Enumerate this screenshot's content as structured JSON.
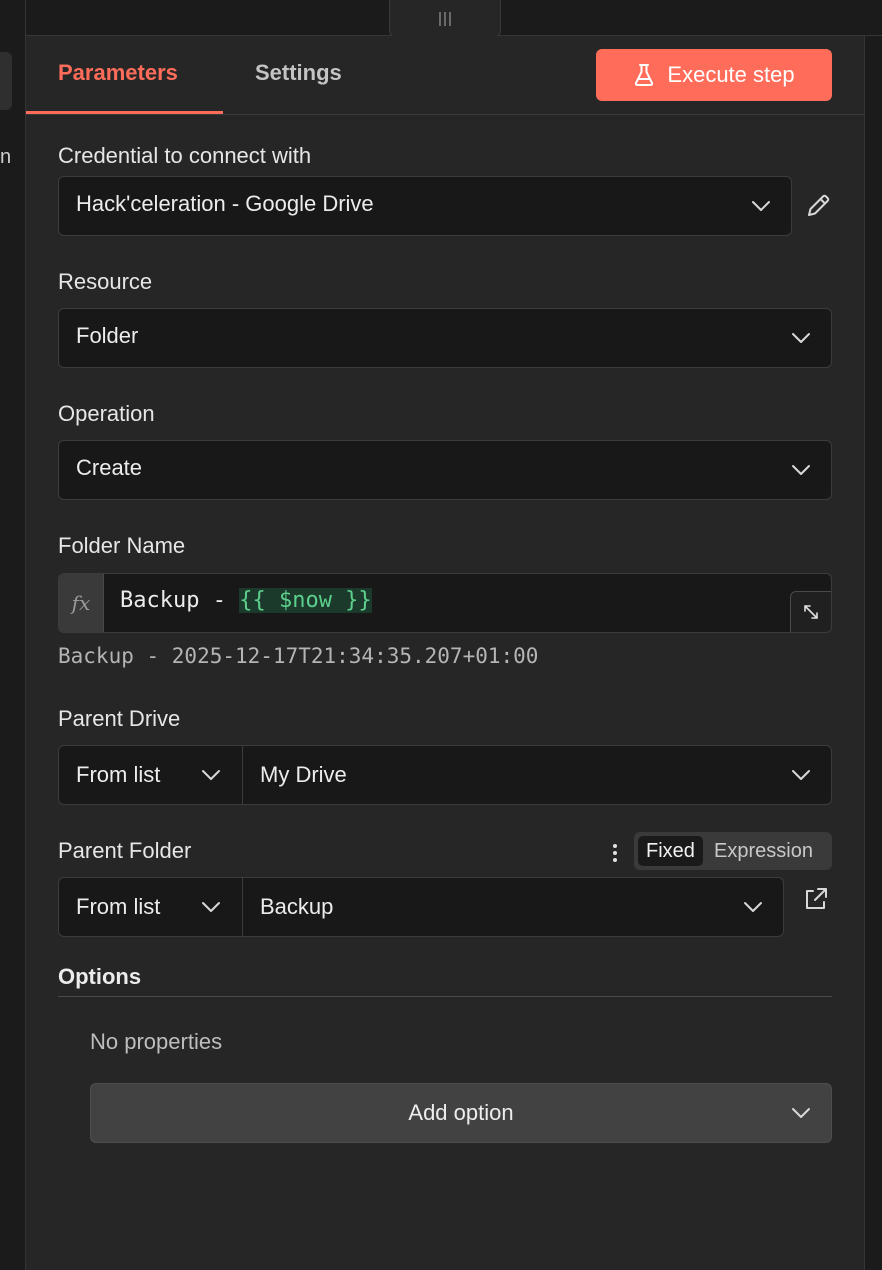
{
  "tabs": {
    "parameters": "Parameters",
    "settings": "Settings"
  },
  "execute_button": {
    "label": "Execute step",
    "icon": "flask-icon"
  },
  "left_strip": {
    "partial_letter": "n"
  },
  "credential": {
    "label": "Credential to connect with",
    "value": "Hack'celeration - Google Drive",
    "edit_icon": "pencil-icon"
  },
  "resource": {
    "label": "Resource",
    "value": "Folder"
  },
  "operation": {
    "label": "Operation",
    "value": "Create"
  },
  "folder_name": {
    "label": "Folder Name",
    "fx": "fx",
    "expression_prefix": "Backup - ",
    "expression_token": "{{ $now }}",
    "preview": "Backup - 2025-12-17T21:34:35.207+01:00"
  },
  "parent_drive": {
    "label": "Parent Drive",
    "mode": "From list",
    "value": "My Drive"
  },
  "parent_folder": {
    "label": "Parent Folder",
    "mode": "From list",
    "value": "Backup",
    "toggle_fixed": "Fixed",
    "toggle_expression": "Expression",
    "selected_toggle": "Fixed"
  },
  "options": {
    "title": "Options",
    "empty_text": "No properties",
    "add_button": "Add option"
  },
  "colors": {
    "accent": "#ff6d5a",
    "panel_bg": "#262626",
    "field_bg": "#181818",
    "expression_green": "#5ccf8c"
  }
}
